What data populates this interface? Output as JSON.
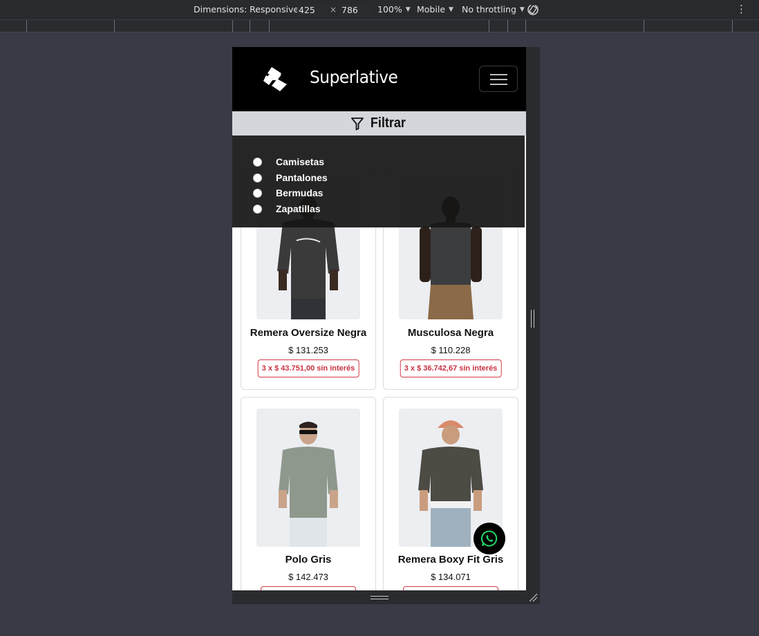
{
  "devtools": {
    "dimensions_label": "Dimensions: Responsive",
    "width": "425",
    "times": "×",
    "height": "786",
    "zoom": "100%",
    "device_type": "Mobile",
    "throttling": "No throttling"
  },
  "site": {
    "brand": "Superlative",
    "filter_label": "Filtrar",
    "filter_options": [
      "Camisetas",
      "Pantalones",
      "Bermudas",
      "Zapatillas"
    ],
    "products": [
      {
        "name": "Remera Oversize Negra",
        "price": "$ 131.253",
        "installments": "3 x $ 43.751,00 sin interés"
      },
      {
        "name": "Musculosa Negra",
        "price": "$ 110.228",
        "installments": "3 x $ 36.742,67 sin interés"
      },
      {
        "name": "Polo Gris",
        "price": "$ 142.473",
        "installments": ""
      },
      {
        "name": "Remera Boxy Fit Gris",
        "price": "$ 134.071",
        "installments": ""
      }
    ]
  },
  "colors": {
    "navbar": "#000000",
    "filter_bar": "#d3d6db",
    "installment_accent": "#c93140",
    "whatsapp": "#25d366"
  }
}
